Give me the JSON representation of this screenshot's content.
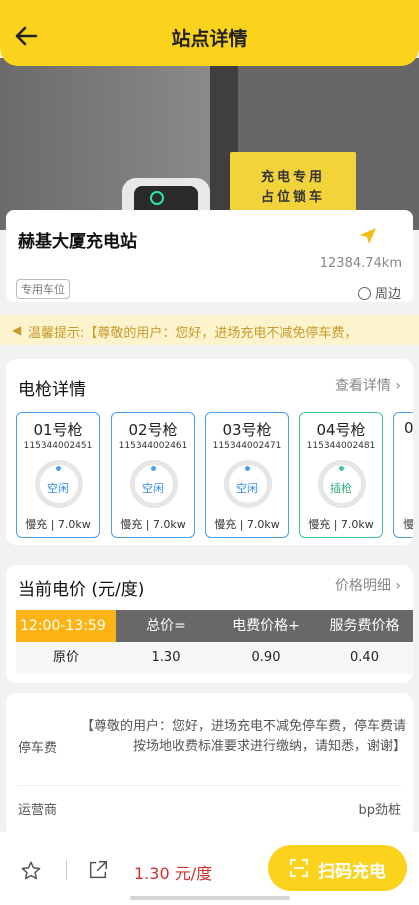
{
  "header": {
    "title": "站点详情"
  },
  "photo": {
    "sign_line1": "充电专用",
    "sign_line2": "占位锁车"
  },
  "station": {
    "name": "赫基大厦充电站",
    "distance": "12384.74km",
    "tag": "专用车位",
    "nearby_label": "周边"
  },
  "notice": {
    "text": "温馨提示:【尊敬的用户：您好，进场充电不减免停车费，"
  },
  "guns_section": {
    "title": "电枪详情",
    "link": "查看详情",
    "guns": [
      {
        "name": "01号枪",
        "id": "115344002451",
        "status": "空闲",
        "spec": "慢充 | 7.0kw"
      },
      {
        "name": "02号枪",
        "id": "115344002461",
        "status": "空闲",
        "spec": "慢充 | 7.0kw"
      },
      {
        "name": "03号枪",
        "id": "115344002471",
        "status": "空闲",
        "spec": "慢充 | 7.0kw"
      },
      {
        "name": "04号枪",
        "id": "115344002481",
        "status": "插枪",
        "spec": "慢充 | 7.0kw"
      },
      {
        "name": "0",
        "id": "",
        "status": "",
        "spec": "慢"
      }
    ]
  },
  "price_section": {
    "title": "当前电价 (元/度)",
    "link": "价格明细",
    "time": "12:00-13:59",
    "headers": [
      "总价=",
      "电费价格+",
      "服务费价格"
    ],
    "row": {
      "label": "原价",
      "total": "1.30",
      "elec": "0.90",
      "service": "0.40"
    }
  },
  "info": {
    "parking_label": "停车费",
    "parking_text": "【尊敬的用户：您好，进场充电不减免停车费，停车费请按场地收费标准要求进行缴纳，请知悉，谢谢】",
    "operator_label": "运营商",
    "operator_value": "bp劲桩"
  },
  "bottom": {
    "price_text": "1.30 元/度",
    "scan_label": "扫码充电"
  },
  "colors": {
    "brand_yellow": "#fbd21c",
    "idle_blue": "#4aa0e6",
    "plugged_green": "#3ec68f",
    "price_red": "#d0312d"
  }
}
